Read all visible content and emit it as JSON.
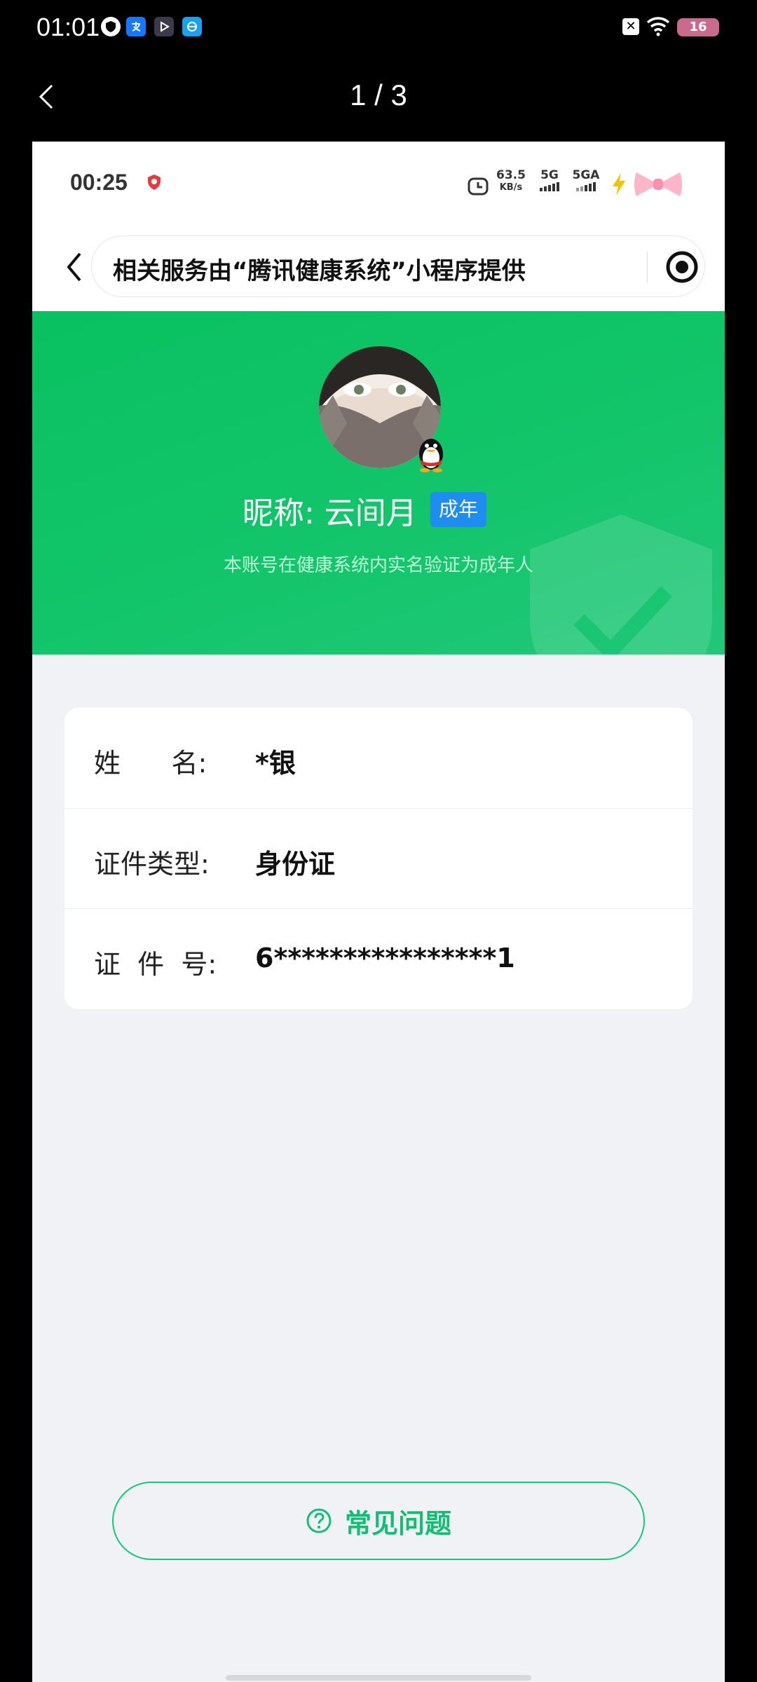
{
  "outer_status": {
    "time": "01:01",
    "battery": "16"
  },
  "viewer": {
    "counter": "1 / 3"
  },
  "inner_status": {
    "time": "00:25",
    "net_speed": "63.5",
    "net_unit": "KB/s",
    "sim1": "5G",
    "sim2": "5GA"
  },
  "mini_program": {
    "notice": "相关服务由“腾讯健康系统”小程序提供"
  },
  "profile": {
    "nickname": "昵称: 云间月",
    "badge": "成年",
    "verify_note": "本账号在健康系统内实名验证为成年人"
  },
  "info_rows": [
    {
      "label": "姓      名:",
      "value": "*银"
    },
    {
      "label": "证件类型:",
      "value": "身份证"
    },
    {
      "label": "证  件  号:",
      "value": "6****************1"
    }
  ],
  "faq": {
    "label": "常见问题"
  },
  "colors": {
    "green": "#09c161",
    "badge_blue": "#1f8cf0",
    "faq_green": "#14bd74",
    "background": "#f0f2f5"
  }
}
